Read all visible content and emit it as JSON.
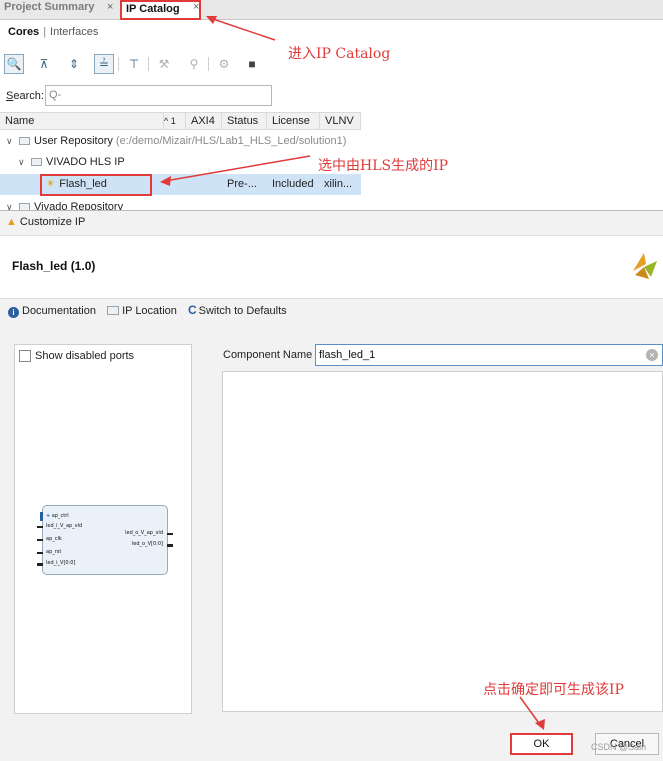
{
  "tabs": {
    "inactive": "Project Summary",
    "active": "IP Catalog",
    "close": "×"
  },
  "subtabs": {
    "cores": "Cores",
    "separator": "|",
    "interfaces": "Interfaces"
  },
  "search": {
    "label_underlined": "S",
    "label_rest": "earch:",
    "placeholder": "Q-"
  },
  "table": {
    "headers": [
      "Name",
      "^ 1",
      "AXI4",
      "Status",
      "License",
      "VLNV"
    ],
    "user_repo": {
      "name": "User Repository",
      "path": "(e:/demo/Mizair/HLS/Lab1_HLS_Led/solution1)"
    },
    "vivado_hls": {
      "name": "VIVADO HLS IP"
    },
    "flash_led": {
      "name": "Flash_led",
      "status": "Pre-...",
      "license": "Included",
      "vlnv": "xilin..."
    },
    "vivado_repo": {
      "name": "Vivado Repository"
    }
  },
  "annotations": {
    "enter_catalog": "进入IP Catalog",
    "select_ip": "选中由HLS生成的IP",
    "click_ok": "点击确定即可生成该IP"
  },
  "dialog": {
    "title": "Customize IP",
    "ip_title": "Flash_led (1.0)",
    "links": {
      "documentation": "Documentation",
      "ip_location": "IP Location",
      "defaults": "Switch to Defaults"
    },
    "show_disabled": "Show disabled ports",
    "component_label": "Component Name",
    "component_value": "flash_led_1",
    "ok": "OK",
    "cancel": "Cancel",
    "watermark": "CSDN @Sain"
  },
  "ip_block": {
    "left_ports": [
      "ap_ctrl",
      "led_i_V_ap_vld",
      "ap_clk",
      "ap_rst",
      "led_i_V[0:0]"
    ],
    "right_ports": [
      "led_o_V_ap_vld",
      "led_o_V[0:0]"
    ]
  },
  "colors": {
    "highlight": "#e03a3a",
    "selection": "#cfe3f7",
    "vivado_orange": "#e3a025"
  }
}
